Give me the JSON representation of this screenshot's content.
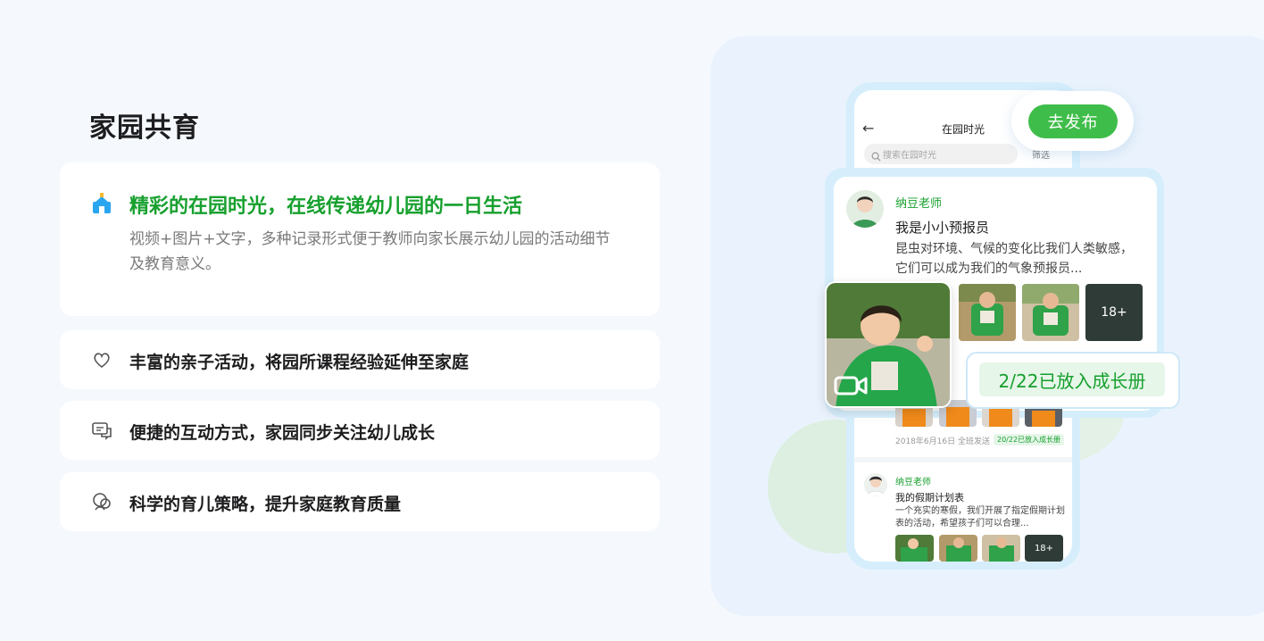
{
  "section": {
    "title": "家园共育"
  },
  "features": [
    {
      "title": "精彩的在园时光，在线传递幼儿园的一日生活",
      "desc": "视频+图片+文字，多种记录形式便于教师向家长展示幼儿园的活动细节及教育意义。",
      "icon": "kindergarten-icon"
    },
    {
      "title": "丰富的亲子活动，将园所课程经验延伸至家庭",
      "icon": "heart-icon"
    },
    {
      "title": "便捷的互动方式，家园同步关注幼儿成长",
      "icon": "chat-icon"
    },
    {
      "title": "科学的育儿策略，提升家庭教育质量",
      "icon": "parenting-icon"
    }
  ],
  "phone": {
    "title": "在园时光",
    "search_placeholder": "搜索在园时光",
    "filter_label": "筛选",
    "publish_button": "去发布",
    "post1": {
      "author": "纳豆老师",
      "title": "我是小小预报员",
      "body": "昆虫对环境、气候的变化比我们人类敏感，它们可以成为我们的气象预报员...",
      "more_count": "18+",
      "badge": "2/22已放入成长册",
      "date": "2018年6月16日 全班发送",
      "tag": "20/22已放入成长册"
    },
    "post2": {
      "author": "纳豆老师",
      "title": "我的假期计划表",
      "body": "一个充实的寒假，我们开展了指定假期计划表的活动，希望孩子们可以合理...",
      "more_count": "18+"
    }
  },
  "colors": {
    "accent": "#17a02e",
    "button": "#3fbd4a",
    "panel": "#eaf3fd",
    "page": "#f5f9fd"
  }
}
